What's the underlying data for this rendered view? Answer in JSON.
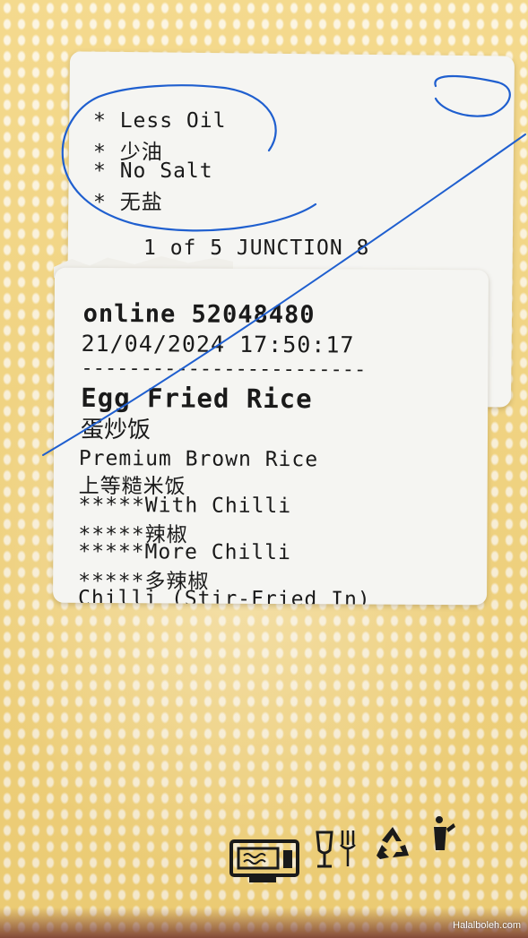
{
  "top_label": {
    "notes": [
      "* Less Oil",
      "* 少油",
      "* No Salt",
      "* 无盐"
    ],
    "sequence": "1 of 5 JUNCTION 8"
  },
  "main_label": {
    "order_ref": "online 52048480",
    "datetime": "21/04/2024 17:50:17",
    "separator": "------------------------",
    "item_name": "Egg Fried Rice",
    "item_name_cn": "蛋炒饭",
    "lines": [
      "Premium Brown Rice",
      "上等糙米饭",
      "*****With Chilli",
      "*****辣椒",
      "*****More Chilli",
      "*****多辣椒",
      "Chilli (Stir-Fried In)"
    ]
  },
  "watermark": "Halalboleh.com",
  "icons": [
    "microwave-safe-icon",
    "food-safe-icon",
    "recycle-icon",
    "bin-icon"
  ],
  "colors": {
    "container": "#f2d37a",
    "ink": "#1f5fcf",
    "label": "#f5f5f2"
  }
}
